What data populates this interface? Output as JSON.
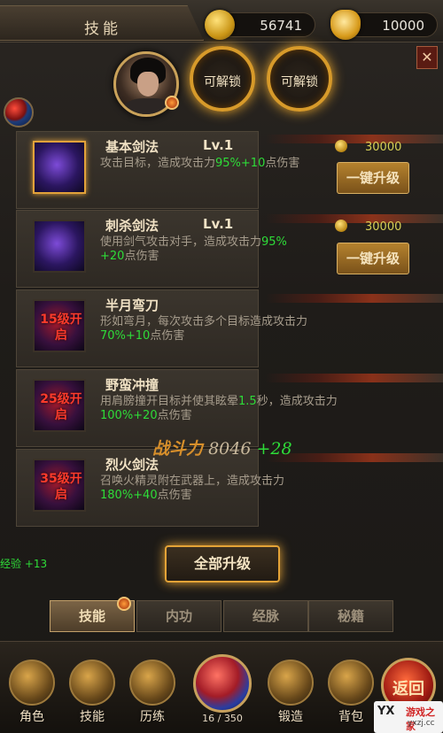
{
  "header": {
    "title": "技能",
    "coin_value": "56741",
    "ingot_value": "10000",
    "close_icon": "close-icon"
  },
  "unlock_slots": [
    "可解锁",
    "可解锁"
  ],
  "skills": [
    {
      "name": "基本剑法",
      "level": "Lv.1",
      "desc_pre": "攻击目标，造成攻击力",
      "desc_g1": "95%+10",
      "desc_mid": "点伤害",
      "desc_g2": "",
      "desc_post": "",
      "lock": "",
      "cost": "30000",
      "button": "一键升级"
    },
    {
      "name": "刺杀剑法",
      "level": "Lv.1",
      "desc_pre": "使用剑气攻击对手，造成攻击力",
      "desc_g1": "95%",
      "desc_mid": "",
      "desc_g2": "+20",
      "desc_post": "点伤害",
      "lock": "",
      "cost": "30000",
      "button": "一键升级"
    },
    {
      "name": "半月弯刀",
      "level": "",
      "desc_pre": "形如弯月，每次攻击多个目标造成攻击力",
      "desc_g1": "70%+10",
      "desc_mid": "点伤害",
      "desc_g2": "",
      "desc_post": "",
      "lock": "15级开启",
      "cost": "",
      "button": ""
    },
    {
      "name": "野蛮冲撞",
      "level": "",
      "desc_pre": "用肩膀撞开目标并使其眩晕",
      "desc_g1": "1.5",
      "desc_mid": "秒，造成攻击力",
      "desc_g2": "100%+20",
      "desc_post": "点伤害",
      "lock": "25级开启",
      "cost": "",
      "button": ""
    },
    {
      "name": "烈火剑法",
      "level": "",
      "desc_pre": "召唤火精灵附在武器上，造成攻击力",
      "desc_g1": "180%+40",
      "desc_mid": "点伤害",
      "desc_g2": "",
      "desc_post": "",
      "lock": "35级开启",
      "cost": "",
      "button": ""
    }
  ],
  "power": {
    "label": "战斗力",
    "value": "8046",
    "delta": "+28"
  },
  "exp_text": "经验 +13",
  "upgrade_all": "全部升级",
  "sub_tabs": [
    "技能",
    "内功",
    "经脉",
    "秘籍"
  ],
  "bottom_nav": {
    "items": [
      "角色",
      "技能",
      "历练",
      "锻造",
      "背包"
    ],
    "center_value": "16 / 350",
    "back_label": "返回"
  },
  "watermark": {
    "logo": "YX",
    "name": "游戏之家",
    "site": "yxzj.cc"
  },
  "colors": {
    "accent_gold": "#e4a337",
    "highlight_green": "#2edc38",
    "lock_red": "#ff3b2b"
  }
}
